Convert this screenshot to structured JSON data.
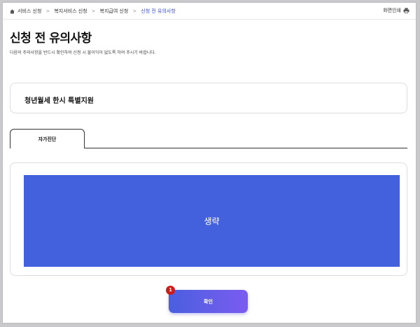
{
  "breadcrumb": {
    "items": [
      {
        "label": "서비스 신청"
      },
      {
        "label": "복지서비스 신청"
      },
      {
        "label": "복지급여 신청"
      },
      {
        "label": "신청 전 유의사항"
      }
    ],
    "separator": ">"
  },
  "print": {
    "label": "화면인쇄",
    "icon": "printer-icon"
  },
  "page": {
    "title": "신청 전 유의사항",
    "subtitle": "다음의 주의사항을 반드시 확인하여 신청 시 불이익이 없도록 하여 주시기 바랍니다."
  },
  "program": {
    "name": "청년월세 한시 특별지원"
  },
  "tabs": [
    {
      "label": "자가진단",
      "selected": true
    }
  ],
  "content": {
    "placeholder": "생략",
    "color": "#4361dc"
  },
  "confirm": {
    "label": "확인",
    "badge": "1"
  },
  "colors": {
    "accent": "#4361dc",
    "breadcrumb_current": "#3a4ee0",
    "badge": "#cc1b1b"
  }
}
